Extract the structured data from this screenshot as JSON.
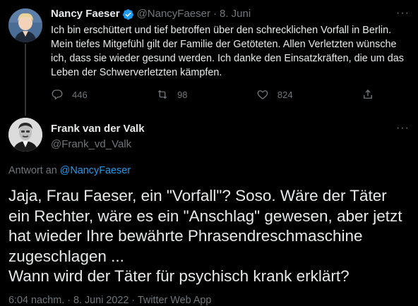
{
  "tweet1": {
    "author_name": "Nancy Faeser",
    "handle": "@NancyFaeser",
    "date": "8. Juni",
    "text": "Ich bin erschüttert und tief betroffen über den schrecklichen Vorfall in Berlin. Mein tiefes Mitgefühl gilt der Familie der Getöteten. Allen Verletzten wünsche ich, dass sie wieder gesund werden. Ich danke den Einsatzkräften, die um das Leben der Schwerverletzten kämpfen.",
    "reply_count": "446",
    "retweet_count": "98",
    "like_count": "824",
    "more_label": "···"
  },
  "tweet2": {
    "author_name": "Frank van der Valk",
    "handle": "@Frank_vd_Valk",
    "more_label": "···",
    "reply_prefix": "Antwort an",
    "reply_handle": "@NancyFaeser",
    "text_line1": "Jaja, Frau Faeser, ein \"Vorfall\"? Soso. Wäre der Täter ein Rechter, wäre es ein \"Anschlag\" gewesen, aber jetzt hat wieder Ihre bewährte Phrasendreschmaschine zugeschlagen ...",
    "text_line2": "Wann wird der Täter für psychisch krank erklärt?",
    "meta": "6:04 nachm. · 8. Juni 2022 · Twitter Web App"
  },
  "colors": {
    "background": "#000000",
    "text": "#e7e9ea",
    "muted": "#71767b",
    "link": "#1d9bf0",
    "verified": "#1d9bf0"
  },
  "icons": [
    "verified-badge-icon",
    "reply-icon",
    "retweet-icon",
    "like-icon",
    "share-icon",
    "more-icon"
  ]
}
